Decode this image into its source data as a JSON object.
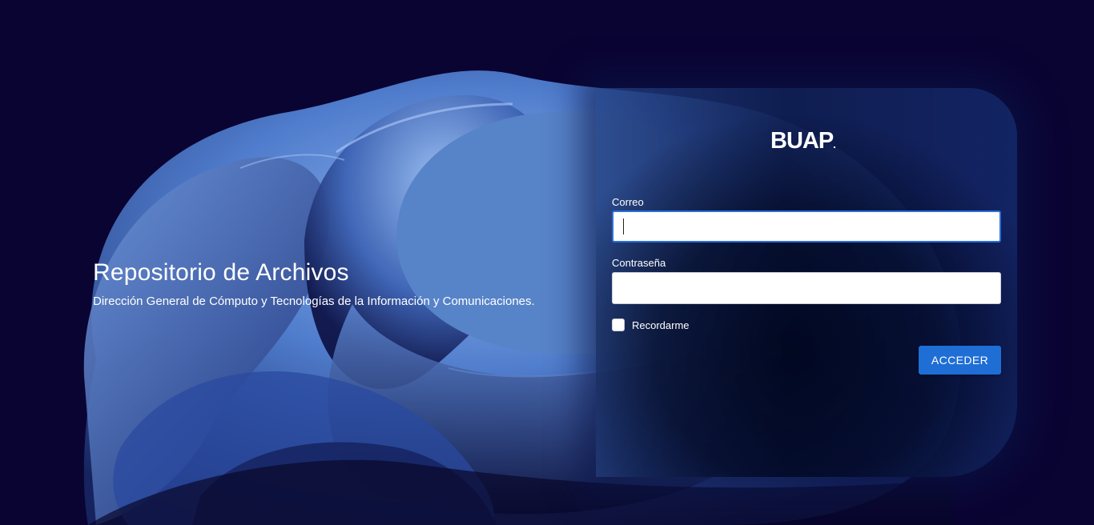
{
  "hero": {
    "title": "Repositorio de Archivos",
    "subtitle": "Dirección General de Cómputo y Tecnologías de la Información y Comunicaciones."
  },
  "login": {
    "logo_text": "BUAP",
    "email_label": "Correo",
    "email_value": "",
    "password_label": "Contraseña",
    "password_value": "",
    "remember_label": "Recordarme",
    "remember_checked": false,
    "submit_label": "ACCEDER"
  },
  "colors": {
    "background": "#0a0433",
    "accent": "#1f6ed6",
    "focus_border": "#2a6fd6"
  },
  "icons": {
    "background_art": "abstract-blue-bloom-wallpaper"
  }
}
